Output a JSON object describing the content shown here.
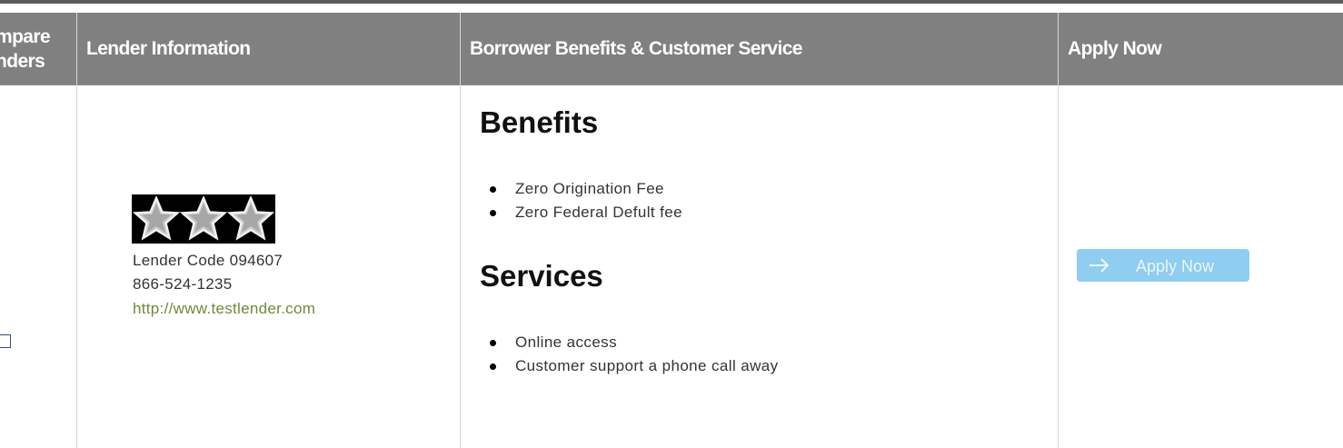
{
  "header": {
    "col1_line1": "mpare",
    "col1_line2": "nders",
    "col2": "Lender Information",
    "col3": "Borrower Benefits & Customer Service",
    "col4": "Apply Now"
  },
  "lender": {
    "rating_stars": 3,
    "code": "Lender Code 094607",
    "phone": "866-524-1235",
    "website": "http://www.testlender.com"
  },
  "benefits": {
    "title": "Benefits",
    "items": [
      "Zero Origination Fee",
      "Zero Federal Defult fee"
    ]
  },
  "services": {
    "title": "Services",
    "items": [
      "Online access",
      "Customer support a phone call away"
    ]
  },
  "apply": {
    "button_label": "Apply Now",
    "button_color": "#8fcdf1"
  },
  "colors": {
    "header_bg": "#808080",
    "link": "#6e8a3a"
  }
}
